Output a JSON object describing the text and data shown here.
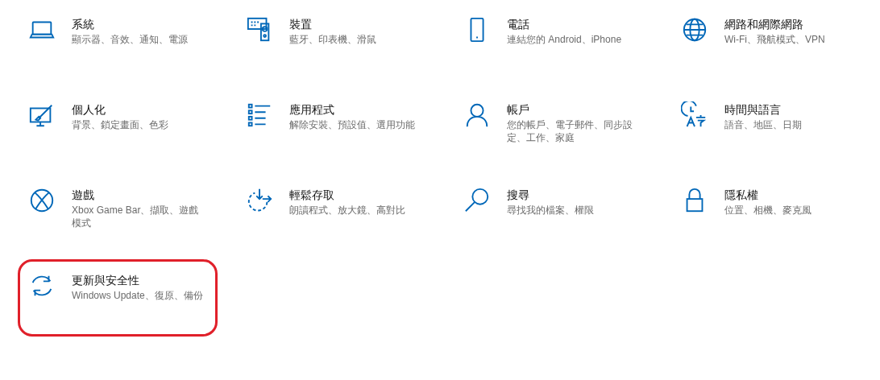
{
  "categories": [
    {
      "title": "系統",
      "description": "顯示器、音效、通知、電源",
      "highlighted": false
    },
    {
      "title": "裝置",
      "description": "藍牙、印表機、滑鼠",
      "highlighted": false
    },
    {
      "title": "電話",
      "description": "連結您的 Android、iPhone",
      "highlighted": false
    },
    {
      "title": "網路和網際網路",
      "description": "Wi-Fi、飛航模式、VPN",
      "highlighted": false
    },
    {
      "title": "個人化",
      "description": "背景、鎖定畫面、色彩",
      "highlighted": false
    },
    {
      "title": "應用程式",
      "description": "解除安裝、預設值、選用功能",
      "highlighted": false
    },
    {
      "title": "帳戶",
      "description": "您的帳戶、電子郵件、同步設定、工作、家庭",
      "highlighted": false
    },
    {
      "title": "時間與語言",
      "description": "語音、地區、日期",
      "highlighted": false
    },
    {
      "title": "遊戲",
      "description": "Xbox Game Bar、擷取、遊戲模式",
      "highlighted": false
    },
    {
      "title": "輕鬆存取",
      "description": "朗讀程式、放大鏡、高對比",
      "highlighted": false
    },
    {
      "title": "搜尋",
      "description": "尋找我的檔案、權限",
      "highlighted": false
    },
    {
      "title": "隱私權",
      "description": "位置、相機、麥克風",
      "highlighted": false
    },
    {
      "title": "更新與安全性",
      "description": "Windows Update、復原、備份",
      "highlighted": true
    }
  ]
}
